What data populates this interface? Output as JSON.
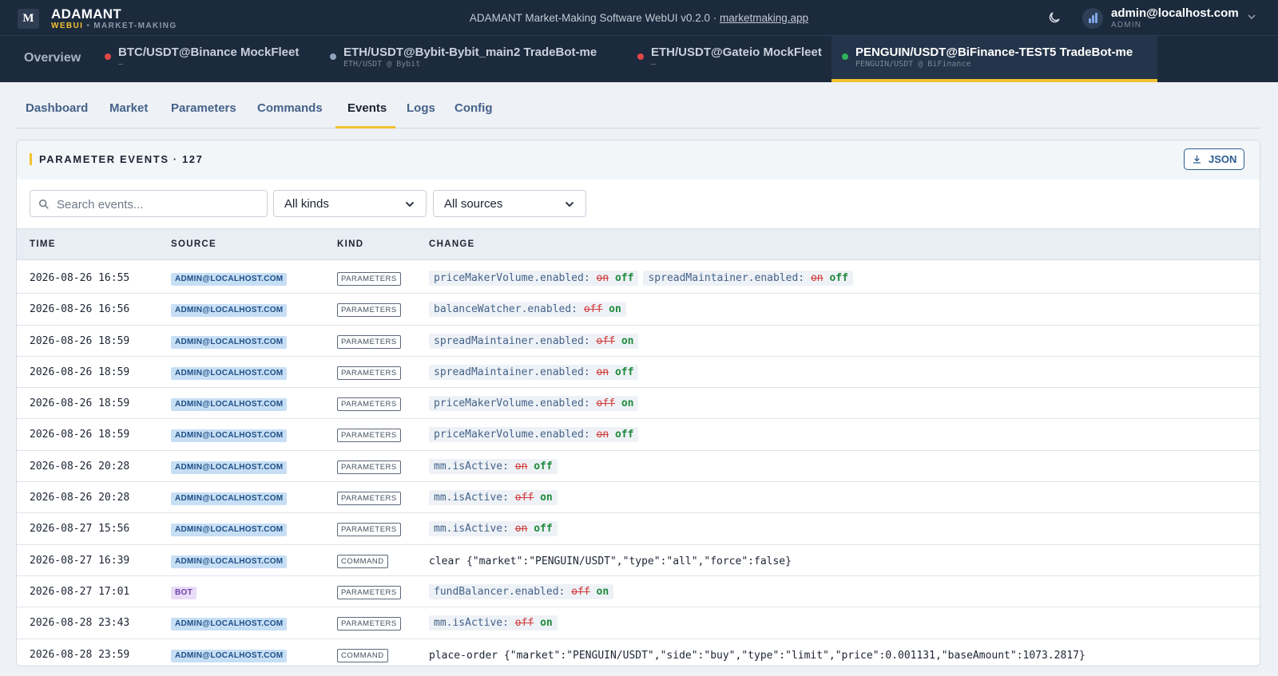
{
  "brand": {
    "name": "ADAMANT",
    "sub_webui": "WEBUI",
    "sub_dot": "•",
    "sub_mm": "MARKET-MAKING",
    "logo": "M"
  },
  "app_title": {
    "text": "ADAMANT Market-Making Software WebUI v0.2.0 · ",
    "link": "marketmaking.app"
  },
  "user": {
    "email": "admin@localhost.com",
    "role": "ADMIN"
  },
  "overview_label": "Overview",
  "bot_tabs": [
    {
      "title": "BTC/USDT@Binance MockFleet",
      "sub": "—",
      "status_color": "#e04848"
    },
    {
      "title": "ETH/USDT@Bybit-Bybit_main2 TradeBot-me",
      "sub": "ETH/USDT @ Bybit",
      "status_color": "#8fa3bd"
    },
    {
      "title": "ETH/USDT@Gateio MockFleet",
      "sub": "—",
      "status_color": "#e04848"
    },
    {
      "title": "PENGUIN/USDT@BiFinance-TEST5 TradeBot-me",
      "sub": "PENGUIN/USDT @ BiFinance",
      "status_color": "#2fb35a",
      "active": true
    }
  ],
  "subtabs": [
    "Dashboard",
    "Market",
    "Parameters",
    "Commands",
    "Events",
    "Logs",
    "Config"
  ],
  "active_subtab": "Events",
  "panel": {
    "title": "PARAMETER EVENTS · 127",
    "json_label": "JSON"
  },
  "filters": {
    "search_placeholder": "Search events...",
    "kind_value": "All kinds",
    "source_value": "All sources"
  },
  "columns": [
    "TIME",
    "SOURCE",
    "KIND",
    "CHANGE"
  ],
  "events": [
    {
      "time": "2026-08-26 16:55",
      "source": "ADMIN@LOCALHOST.COM",
      "source_type": "admin",
      "kind": "PARAMETERS",
      "changes": [
        {
          "key": "priceMakerVolume.enabled:",
          "old": "on",
          "new": "off"
        },
        {
          "key": "spreadMaintainer.enabled:",
          "old": "on",
          "new": "off"
        }
      ]
    },
    {
      "time": "2026-08-26 16:56",
      "source": "ADMIN@LOCALHOST.COM",
      "source_type": "admin",
      "kind": "PARAMETERS",
      "changes": [
        {
          "key": "balanceWatcher.enabled:",
          "old": "off",
          "new": "on"
        }
      ]
    },
    {
      "time": "2026-08-26 18:59",
      "source": "ADMIN@LOCALHOST.COM",
      "source_type": "admin",
      "kind": "PARAMETERS",
      "changes": [
        {
          "key": "spreadMaintainer.enabled:",
          "old": "off",
          "new": "on"
        }
      ]
    },
    {
      "time": "2026-08-26 18:59",
      "source": "ADMIN@LOCALHOST.COM",
      "source_type": "admin",
      "kind": "PARAMETERS",
      "changes": [
        {
          "key": "spreadMaintainer.enabled:",
          "old": "on",
          "new": "off"
        }
      ]
    },
    {
      "time": "2026-08-26 18:59",
      "source": "ADMIN@LOCALHOST.COM",
      "source_type": "admin",
      "kind": "PARAMETERS",
      "changes": [
        {
          "key": "priceMakerVolume.enabled:",
          "old": "off",
          "new": "on"
        }
      ]
    },
    {
      "time": "2026-08-26 18:59",
      "source": "ADMIN@LOCALHOST.COM",
      "source_type": "admin",
      "kind": "PARAMETERS",
      "changes": [
        {
          "key": "priceMakerVolume.enabled:",
          "old": "on",
          "new": "off"
        }
      ]
    },
    {
      "time": "2026-08-26 20:28",
      "source": "ADMIN@LOCALHOST.COM",
      "source_type": "admin",
      "kind": "PARAMETERS",
      "changes": [
        {
          "key": "mm.isActive:",
          "old": "on",
          "new": "off"
        }
      ]
    },
    {
      "time": "2026-08-26 20:28",
      "source": "ADMIN@LOCALHOST.COM",
      "source_type": "admin",
      "kind": "PARAMETERS",
      "changes": [
        {
          "key": "mm.isActive:",
          "old": "off",
          "new": "on"
        }
      ]
    },
    {
      "time": "2026-08-27 15:56",
      "source": "ADMIN@LOCALHOST.COM",
      "source_type": "admin",
      "kind": "PARAMETERS",
      "changes": [
        {
          "key": "mm.isActive:",
          "old": "on",
          "new": "off"
        }
      ]
    },
    {
      "time": "2026-08-27 16:39",
      "source": "ADMIN@LOCALHOST.COM",
      "source_type": "admin",
      "kind": "COMMAND",
      "command": "clear {\"market\":\"PENGUIN/USDT\",\"type\":\"all\",\"force\":false}"
    },
    {
      "time": "2026-08-27 17:01",
      "source": "BOT",
      "source_type": "bot",
      "kind": "PARAMETERS",
      "changes": [
        {
          "key": "fundBalancer.enabled:",
          "old": "off",
          "new": "on"
        }
      ]
    },
    {
      "time": "2026-08-28 23:43",
      "source": "ADMIN@LOCALHOST.COM",
      "source_type": "admin",
      "kind": "PARAMETERS",
      "changes": [
        {
          "key": "mm.isActive:",
          "old": "off",
          "new": "on"
        }
      ]
    },
    {
      "time": "2026-08-28 23:59",
      "source": "ADMIN@LOCALHOST.COM",
      "source_type": "admin",
      "kind": "COMMAND",
      "command": "place-order {\"market\":\"PENGUIN/USDT\",\"side\":\"buy\",\"type\":\"limit\",\"price\":0.001131,\"baseAmount\":1073.2817}"
    }
  ],
  "colors": {
    "accent": "#f2c230",
    "navy": "#1c2a3d",
    "old_value": "#d23a3a",
    "new_value": "#1f8a3c"
  }
}
